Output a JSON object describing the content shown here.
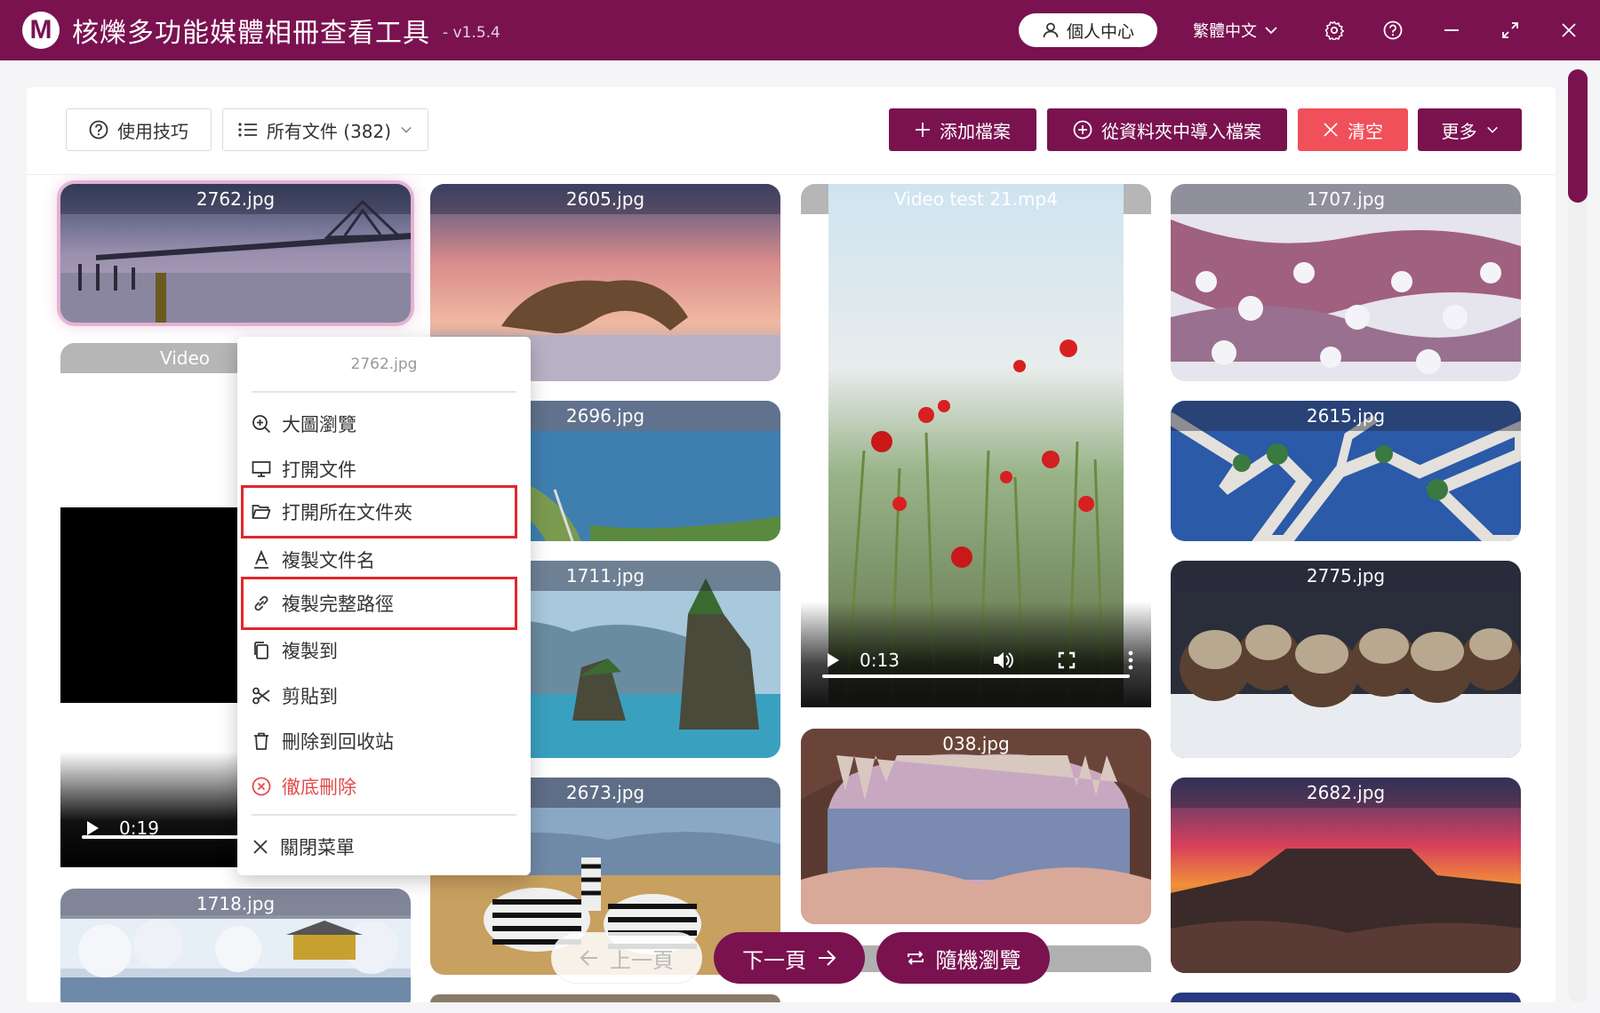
{
  "titlebar": {
    "logo_letter": "M",
    "title": "核爍多功能媒體相冊查看工具",
    "version": "- v1.5.4",
    "user_center": "個人中心",
    "language": "繁體中文"
  },
  "toolbar": {
    "tips": "使用技巧",
    "filter": "所有文件 (382)",
    "add_file": "添加檔案",
    "import_folder": "從資料夾中導入檔案",
    "clear": "清空",
    "more": "更多"
  },
  "cards": [
    {
      "title": "2762.jpg"
    },
    {
      "title": "Video"
    },
    {
      "title": "1718.jpg"
    },
    {
      "title": "2605.jpg"
    },
    {
      "title": "2696.jpg"
    },
    {
      "title": "1711.jpg"
    },
    {
      "title": "2673.jpg"
    },
    {
      "title": "Video test 21.mp4"
    },
    {
      "title": "038.jpg"
    },
    {
      "title": "1707.jpg"
    },
    {
      "title": "2615.jpg"
    },
    {
      "title": "2775.jpg"
    },
    {
      "title": "2682.jpg"
    }
  ],
  "videos": {
    "left_time": "0:19",
    "center_time": "0:13"
  },
  "context_menu": {
    "header": "2762.jpg",
    "items": [
      {
        "label": "大圖瀏覽",
        "icon": "zoom-in-icon"
      },
      {
        "label": "打開文件",
        "icon": "monitor-icon"
      },
      {
        "label": "打開所在文件夾",
        "icon": "folder-open-icon"
      },
      {
        "label": "複製文件名",
        "icon": "text-a-icon"
      },
      {
        "label": "複製完整路徑",
        "icon": "link-icon"
      },
      {
        "label": "複製到",
        "icon": "copy-icon"
      },
      {
        "label": "剪貼到",
        "icon": "scissors-icon"
      },
      {
        "label": "刪除到回收站",
        "icon": "trash-icon"
      },
      {
        "label": "徹底刪除",
        "icon": "close-circle-icon"
      },
      {
        "label": "關閉菜單",
        "icon": "close-icon"
      }
    ]
  },
  "pager": {
    "prev": "上一頁",
    "next": "下一頁",
    "random": "隨機瀏覽"
  },
  "colors": {
    "brand": "#7a1250",
    "danger": "#f0505a",
    "highlight_box": "#e0262d"
  }
}
